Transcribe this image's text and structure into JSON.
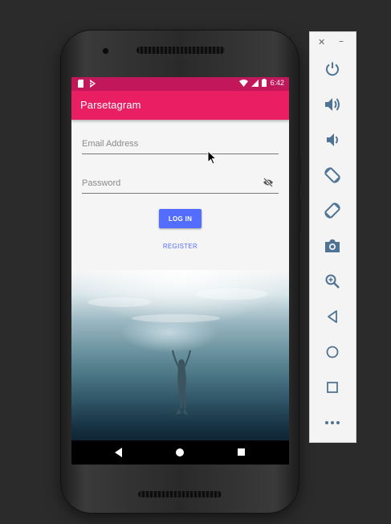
{
  "app": {
    "title": "Parsetagram",
    "status_time": "6:42"
  },
  "login": {
    "email_placeholder": "Email Address",
    "password_placeholder": "Password",
    "login_label": "LOG IN",
    "register_label": "REGISTER"
  },
  "colors": {
    "status_bar": "#c2185b",
    "app_bar": "#e91e63",
    "accent": "#536dfe"
  },
  "emulator_toolbar": {
    "close_label": "✕",
    "minimize_label": "–",
    "buttons": [
      "power-icon",
      "volume-up-icon",
      "volume-down-icon",
      "rotate-left-icon",
      "rotate-right-icon",
      "camera-icon",
      "zoom-icon",
      "back-icon",
      "home-icon",
      "overview-icon",
      "more-icon"
    ]
  },
  "navigation_bar": [
    "back-icon",
    "home-icon",
    "recent-apps-icon"
  ]
}
